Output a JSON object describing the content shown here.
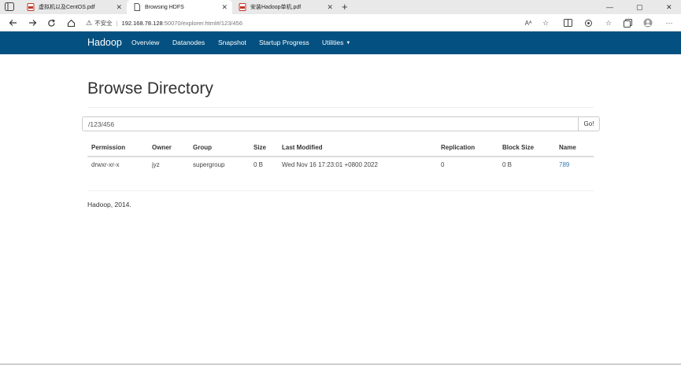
{
  "browser": {
    "tabs": [
      {
        "title": "虚拟机以及CentOS.pdf",
        "icon": "pdf-icon",
        "active": false
      },
      {
        "title": "Browsing HDFS",
        "icon": "page-icon",
        "active": true
      },
      {
        "title": "安装Hadoop单机.pdf",
        "icon": "pdf-icon",
        "active": false
      }
    ],
    "close_glyph": "✕",
    "new_tab_glyph": "+",
    "address": {
      "security_label": "不安全",
      "separator": "|",
      "host": "192.168.78.128",
      "path": ":50070/explorer.html#/123/456"
    },
    "window_controls": {
      "minimize": "—",
      "maximize": "▢",
      "close": "✕"
    }
  },
  "app": {
    "brand": "Hadoop",
    "nav": [
      {
        "label": "Overview"
      },
      {
        "label": "Datanodes"
      },
      {
        "label": "Snapshot"
      },
      {
        "label": "Startup Progress"
      },
      {
        "label": "Utilities"
      }
    ]
  },
  "page": {
    "title": "Browse Directory",
    "directory_input": "/123/456",
    "go_label": "Go!",
    "table": {
      "headers": [
        "Permission",
        "Owner",
        "Group",
        "Size",
        "Last Modified",
        "Replication",
        "Block Size",
        "Name"
      ],
      "rows": [
        [
          "drwxr-xr-x",
          "jyz",
          "supergroup",
          "0 B",
          "Wed Nov 16 17:23:01 +0800 2022",
          "0",
          "0 B",
          "789"
        ]
      ]
    },
    "footer": "Hadoop, 2014."
  },
  "colors": {
    "navbar_bg": "#045080",
    "link": "#337ab7"
  }
}
